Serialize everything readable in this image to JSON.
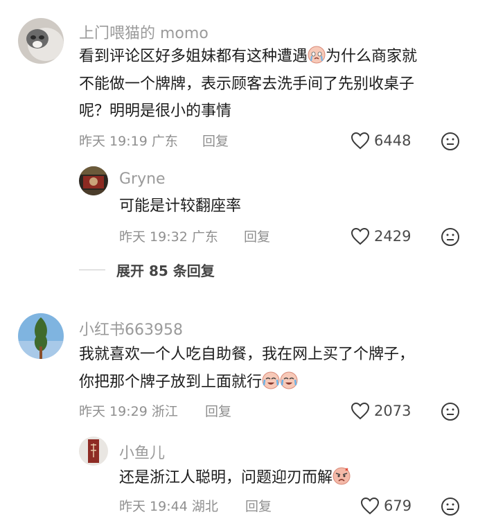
{
  "comments": [
    {
      "username": "上门喂猫的 momo",
      "lines": [
        "看到评论区好多姐妹都有这种遭遇",
        "为什么商家就",
        "不能做一个牌牌，表示顾客去洗手间了先别收桌子",
        "呢？明明是很小的事情"
      ],
      "time": "昨天 19:19",
      "location": "广东",
      "reply_label": "回复",
      "likes": "6448"
    },
    {
      "username": "Gryne",
      "lines": [
        "可能是计较翻座率"
      ],
      "time": "昨天 19:32",
      "location": "广东",
      "reply_label": "回复",
      "likes": "2429"
    },
    {
      "username": "小红书663958",
      "lines": [
        "我就喜欢一个人吃自助餐，我在网上买了个牌子，",
        "你把那个牌子放到上面就行"
      ],
      "time": "昨天 19:29",
      "location": "浙江",
      "reply_label": "回复",
      "likes": "2073"
    },
    {
      "username": "小鱼儿",
      "lines": [
        "还是浙江人聪明，问题迎刃而解"
      ],
      "time": "昨天 19:44",
      "location": "湖北",
      "reply_label": "回复",
      "likes": "679"
    }
  ],
  "expand_replies": "展开 85 条回复",
  "icons": {
    "like": "heart-outline-icon",
    "dislike": "frown-face-icon"
  },
  "colors": {
    "secondary_text": "#9a9a9a",
    "primary_text": "#1c1c1c"
  }
}
